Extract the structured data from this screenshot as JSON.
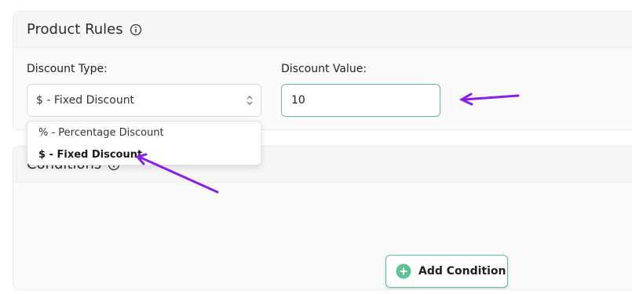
{
  "product_rules": {
    "title": "Product Rules",
    "discount_type_label": "Discount Type:",
    "discount_type_selected": "$ - Fixed Discount",
    "discount_value_label": "Discount Value:",
    "discount_value": "10"
  },
  "dropdown": {
    "options": [
      "% - Percentage Discount",
      "$ - Fixed Discount"
    ]
  },
  "conditions": {
    "title": "Conditions",
    "add_button_label": "Add Condition"
  },
  "colors": {
    "accent_green": "#5cc393",
    "annotation_arrow": "#8a1ee6"
  },
  "icons": {
    "info": "info-icon",
    "select_chevron": "chevron-up-down-icon",
    "add": "plus-circle-icon"
  }
}
